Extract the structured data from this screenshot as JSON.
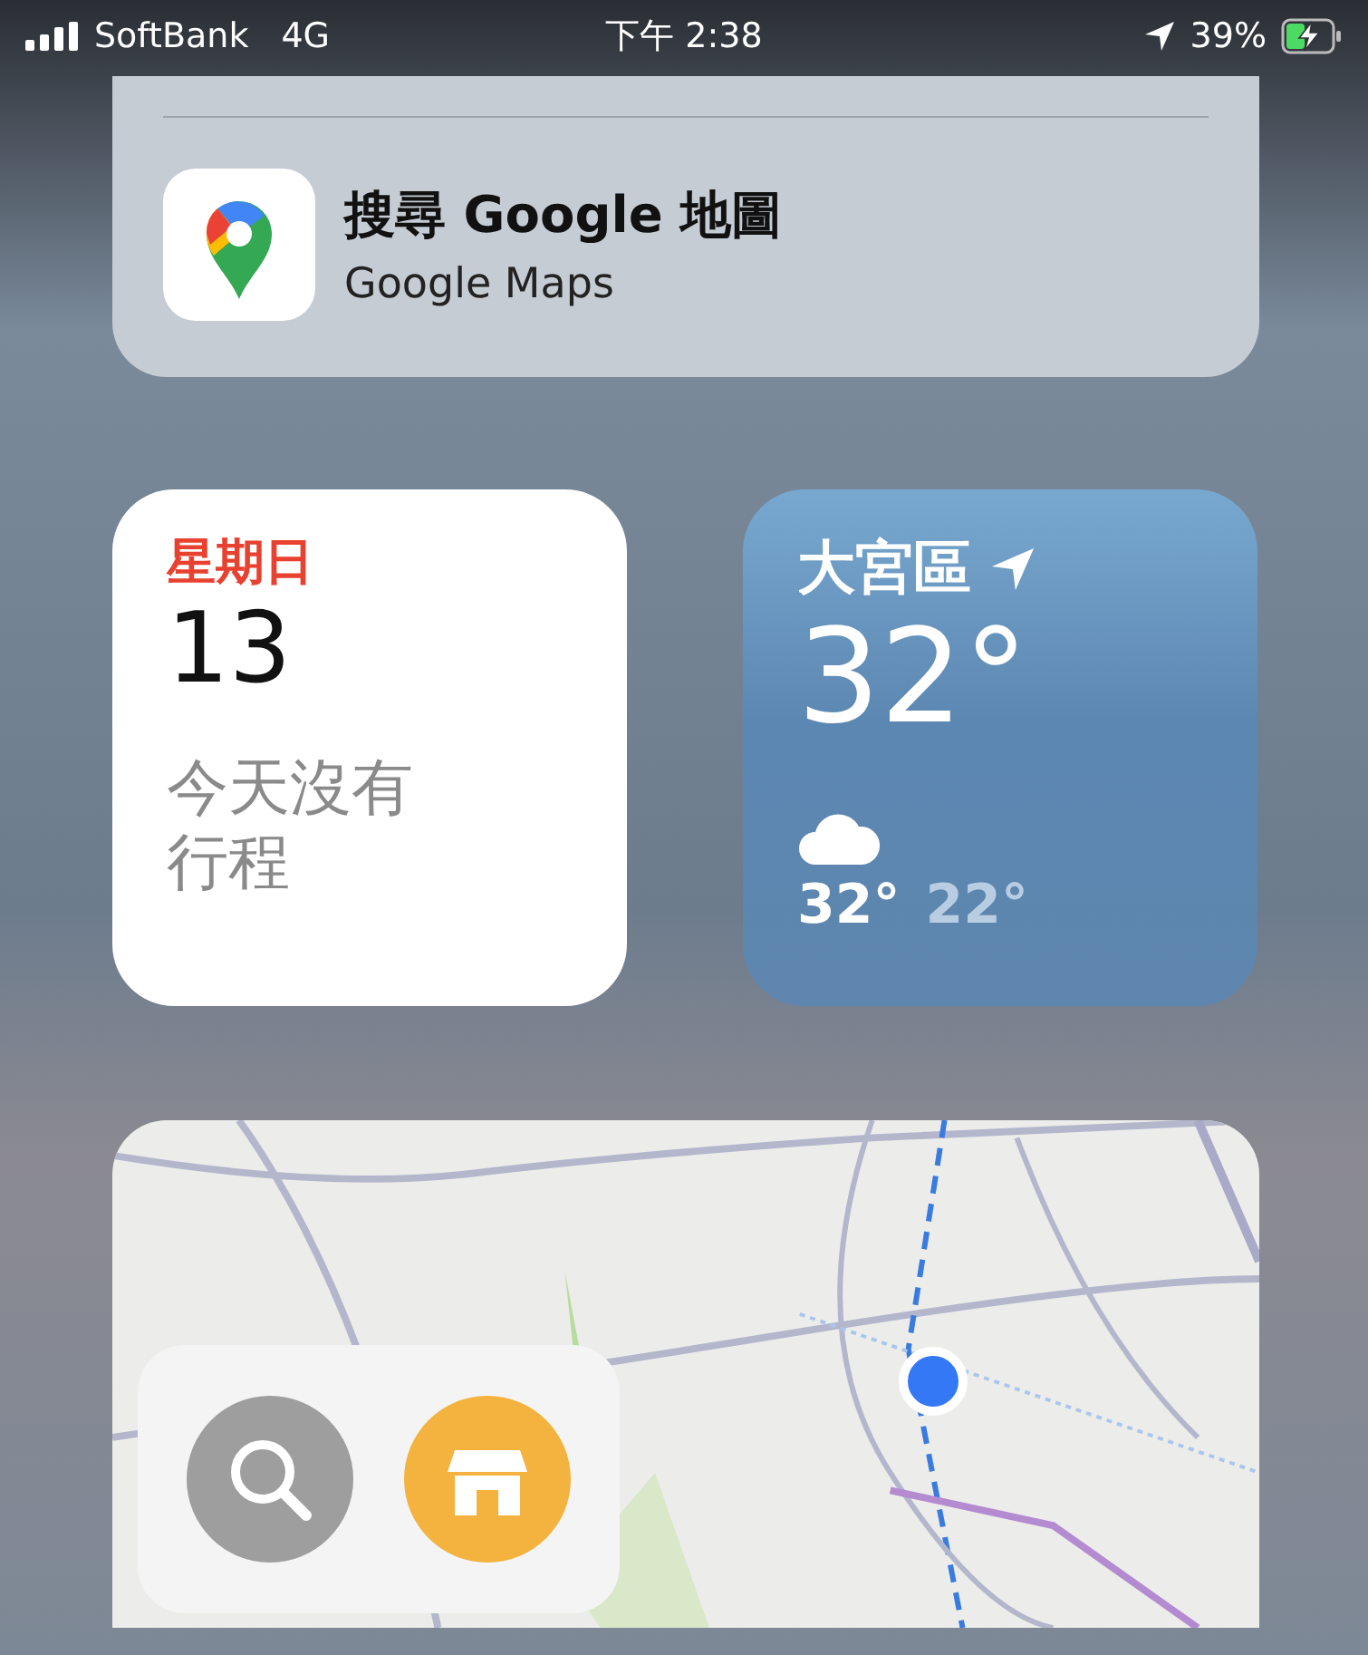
{
  "status_bar": {
    "carrier": "SoftBank",
    "network": "4G",
    "time": "下午 2:38",
    "battery": "39%"
  },
  "search_result": {
    "title": "搜尋 Google 地圖",
    "subtitle": "Google Maps"
  },
  "calendar_widget": {
    "weekday": "星期日",
    "day": "13",
    "message": "今天沒有行程"
  },
  "weather_widget": {
    "location": "大宮區",
    "temperature": "32°",
    "high": "32°",
    "low": "22°"
  },
  "map_widget": {
    "kind": "picture",
    "buttons": [
      {
        "kind": "search"
      },
      {
        "kind": "shop"
      }
    ]
  }
}
